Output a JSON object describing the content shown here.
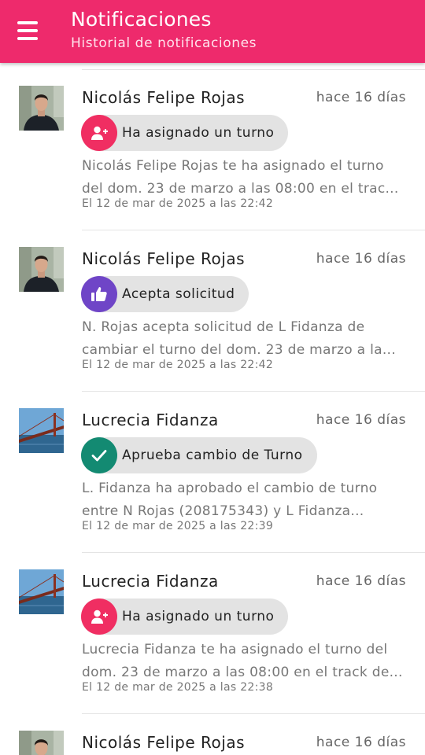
{
  "app_bar": {
    "title": "Notificaciones",
    "subtitle": "Historial de notificaciones",
    "menu_icon": "menu-icon",
    "color": "#ee2a6c"
  },
  "colors": {
    "assign": "#f02e62",
    "accept": "#6f45c7",
    "approve": "#138a72",
    "chip_bg": "#e3e3e3"
  },
  "notifications": [
    {
      "name": "Nicolás Felipe Rojas",
      "time": "hace 16 días",
      "action": "Ha asignado un turno",
      "action_icon": "assign-user-icon",
      "desc_line1": "Nicolás Felipe Rojas te ha asignado el turno",
      "desc_line2": "del dom. 23 de marzo a las 08:00 en el trac...",
      "date": "El 12 de mar de 2025 a las 22:42"
    },
    {
      "name": "Nicolás Felipe Rojas",
      "time": "hace 16 días",
      "action": "Acepta solicitud",
      "action_icon": "thumbs-up-icon",
      "desc_line1": "N. Rojas acepta solicitud de L Fidanza de",
      "desc_line2": "cambiar el turno del dom. 23 de marzo a la...",
      "date": "El 12 de mar de 2025 a las 22:42"
    },
    {
      "name": "Lucrecia Fidanza",
      "time": "hace 16 días",
      "action": "Aprueba cambio de Turno",
      "action_icon": "checkmark-icon",
      "desc_line1": "L. Fidanza ha aprobado el cambio de turno",
      "desc_line2": "entre N Rojas (208175343) y L Fidanza...",
      "date": "El 12 de mar de 2025 a las 22:39"
    },
    {
      "name": "Lucrecia Fidanza",
      "time": "hace 16 días",
      "action": "Ha asignado un turno",
      "action_icon": "assign-user-icon",
      "desc_line1": "Lucrecia Fidanza te ha asignado el turno del",
      "desc_line2": "dom. 23 de marzo a las 08:00 en el track de...",
      "date": "El 12 de mar de 2025 a las 22:38"
    },
    {
      "name": "Nicolás Felipe Rojas",
      "time": "hace 16 días"
    }
  ]
}
